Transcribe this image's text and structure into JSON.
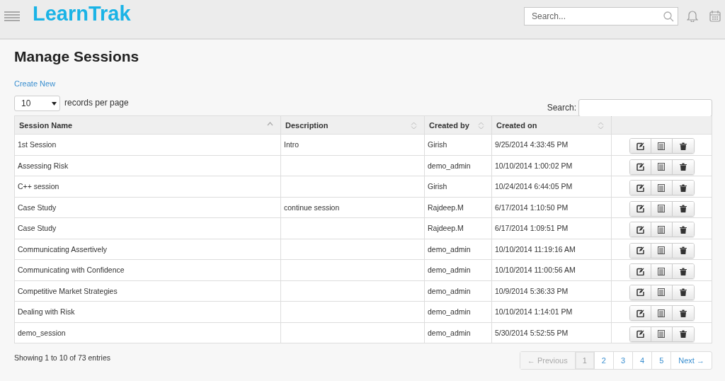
{
  "header": {
    "logo": "LearnTrak",
    "search": {
      "placeholder": "Search..."
    }
  },
  "page": {
    "title": "Manage Sessions",
    "create_link": "Create New",
    "page_size": "10",
    "page_size_label": "records per page",
    "search_label": "Search:"
  },
  "table": {
    "columns": [
      {
        "label": "Session Name",
        "sorted": true
      },
      {
        "label": "Description",
        "sorted": false
      },
      {
        "label": "Created by",
        "sorted": false
      },
      {
        "label": "Created on",
        "sorted": false
      }
    ],
    "rows": [
      [
        "1st Session",
        "Intro",
        "Girish",
        "9/25/2014 4:33:45 PM"
      ],
      [
        "Assessing Risk",
        "",
        "demo_admin",
        "10/10/2014 1:00:02 PM"
      ],
      [
        "C++ session",
        "",
        "Girish",
        "10/24/2014 6:44:05 PM"
      ],
      [
        "Case Study",
        "continue session",
        "Rajdeep.M",
        "6/17/2014 1:10:50 PM"
      ],
      [
        "Case Study",
        "",
        "Rajdeep.M",
        "6/17/2014 1:09:51 PM"
      ],
      [
        "Communicating Assertively",
        "",
        "demo_admin",
        "10/10/2014 11:19:16 AM"
      ],
      [
        "Communicating with Confidence",
        "",
        "demo_admin",
        "10/10/2014 11:00:56 AM"
      ],
      [
        "Competitive Market Strategies",
        "",
        "demo_admin",
        "10/9/2014 5:36:33 PM"
      ],
      [
        "Dealing with Risk",
        "",
        "demo_admin",
        "10/10/2014 1:14:01 PM"
      ],
      [
        "demo_session",
        "",
        "demo_admin",
        "5/30/2014 5:52:55 PM"
      ]
    ]
  },
  "footer": {
    "info": "Showing 1 to 10 of 73 entries",
    "pagination": [
      {
        "label": "← Previous",
        "selected": false,
        "disabled": true
      },
      {
        "label": "1",
        "selected": true,
        "disabled": false
      },
      {
        "label": "2",
        "selected": false,
        "disabled": false
      },
      {
        "label": "3",
        "selected": false,
        "disabled": false
      },
      {
        "label": "4",
        "selected": false,
        "disabled": false
      },
      {
        "label": "5",
        "selected": false,
        "disabled": false
      },
      {
        "label": "Next →",
        "selected": false,
        "disabled": false
      }
    ]
  }
}
